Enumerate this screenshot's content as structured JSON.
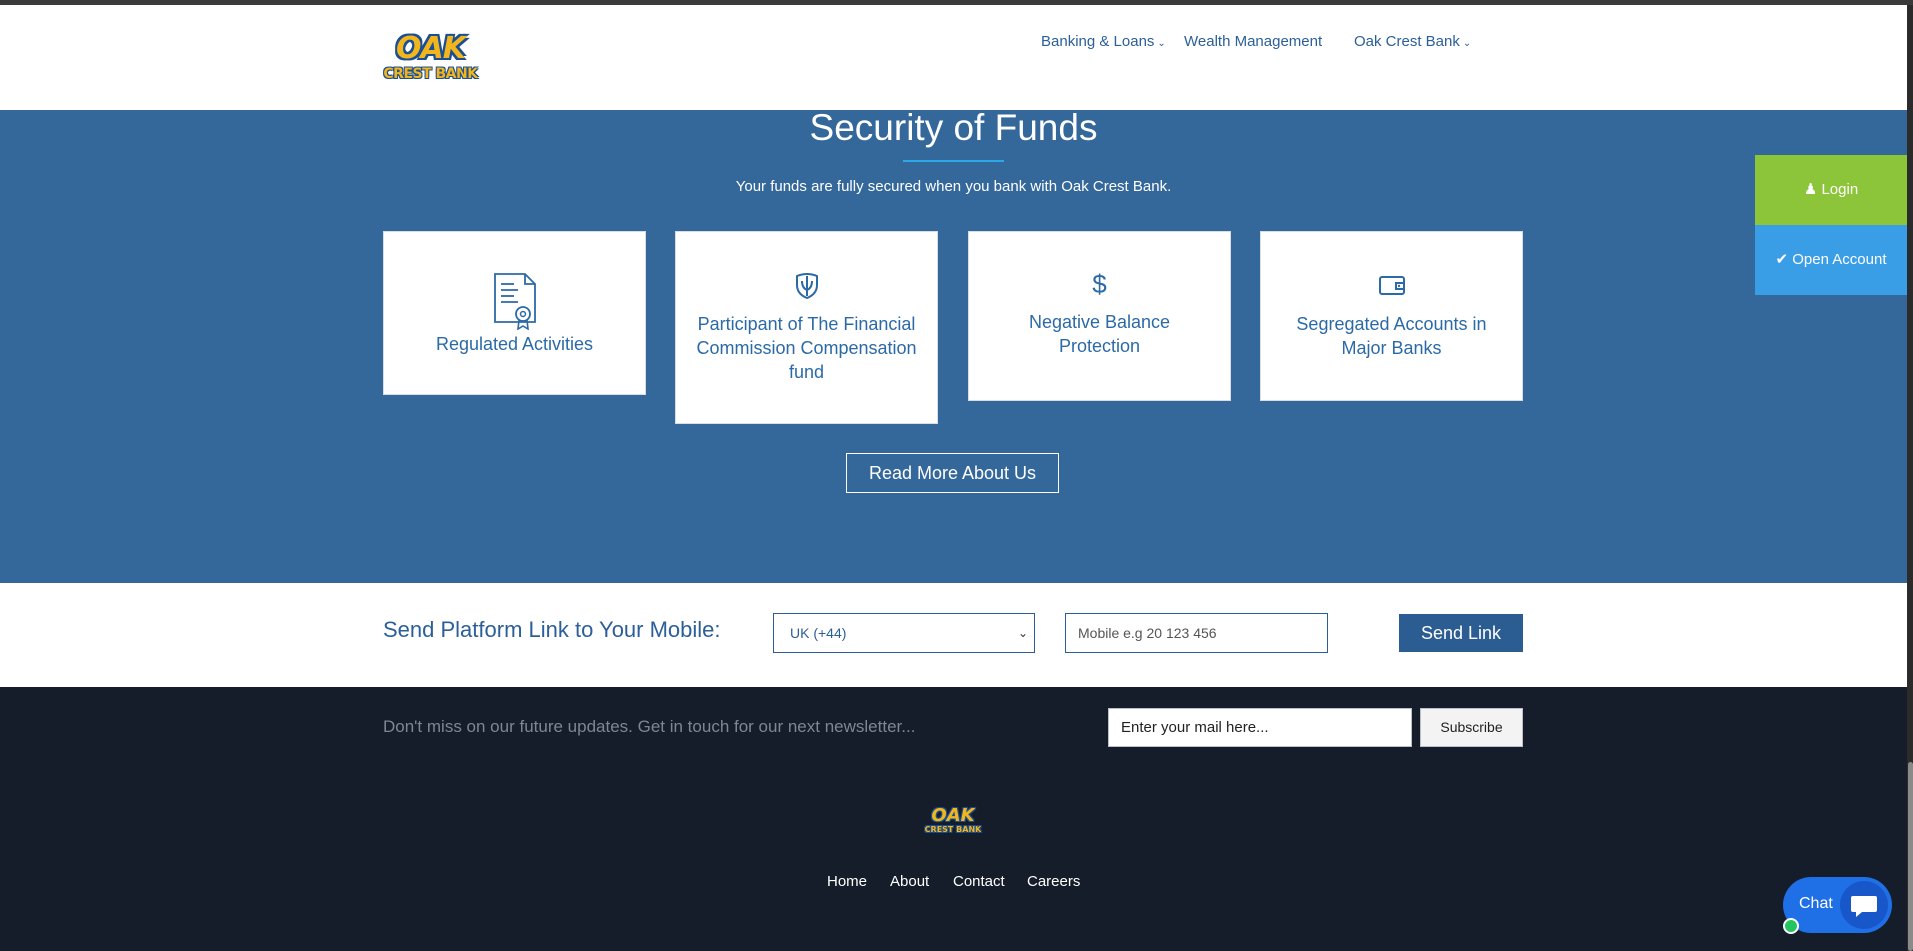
{
  "header": {
    "logo_line1": "OAK",
    "logo_line2": "CREST BANK",
    "nav": [
      {
        "label": "Banking & Loans",
        "dropdown": true
      },
      {
        "label": "Wealth Management",
        "dropdown": false
      },
      {
        "label": "Oak Crest Bank",
        "dropdown": true
      }
    ]
  },
  "funds": {
    "title": "Security of Funds",
    "subtitle": "Your funds are fully secured when you bank with Oak Crest Bank.",
    "cards": [
      {
        "icon": "certificate-document-icon",
        "label": "Regulated Activities"
      },
      {
        "icon": "shield-icon",
        "label": "Participant of The Financial Commission Compensation fund"
      },
      {
        "icon": "dollar-icon",
        "label": "Negative Balance Protection"
      },
      {
        "icon": "wallet-icon",
        "label": "Segregated Accounts in Major Banks"
      }
    ],
    "read_more": "Read More About Us"
  },
  "send_link": {
    "label": "Send Platform Link to Your Mobile:",
    "country_selected": "UK (+44)",
    "mobile_placeholder": "Mobile e.g 20 123 456",
    "button": "Send Link"
  },
  "footer": {
    "newsletter_text": "Don't miss on our future updates. Get in touch for our next newsletter...",
    "email_placeholder": "Enter your mail here...",
    "subscribe": "Subscribe",
    "logo_line1": "OAK",
    "logo_line2": "CREST BANK",
    "links": [
      "Home",
      "About",
      "Contact",
      "Careers"
    ]
  },
  "side": {
    "login": "Login",
    "open_account": "Open Account"
  },
  "chat": {
    "label": "Chat"
  },
  "colors": {
    "primary_blue": "#34679a",
    "login_green": "#8cc43a",
    "open_account_blue": "#3a9ee6",
    "footer_dark": "#151d2b"
  }
}
